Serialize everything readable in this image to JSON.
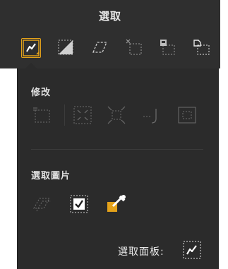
{
  "toolbar": {
    "title": "選取",
    "tools": [
      {
        "name": "auto-select-icon",
        "selected": true
      },
      {
        "name": "rect-select-icon"
      },
      {
        "name": "lasso-select-icon"
      },
      {
        "name": "deselect-icon"
      },
      {
        "name": "select-layer-icon"
      },
      {
        "name": "select-object-icon"
      }
    ],
    "accent": "#e4a21a"
  },
  "modify": {
    "label": "修改",
    "icons": [
      "border-icon",
      "expand-icon",
      "contract-icon",
      "feather-icon",
      "invert-icon"
    ]
  },
  "select_image": {
    "label": "選取圖片",
    "icons": [
      "transform-icon",
      "checkbox-icon",
      "eyedropper-icon"
    ]
  },
  "footer": {
    "label": "選取面板:",
    "icon": "select-panel-icon"
  }
}
